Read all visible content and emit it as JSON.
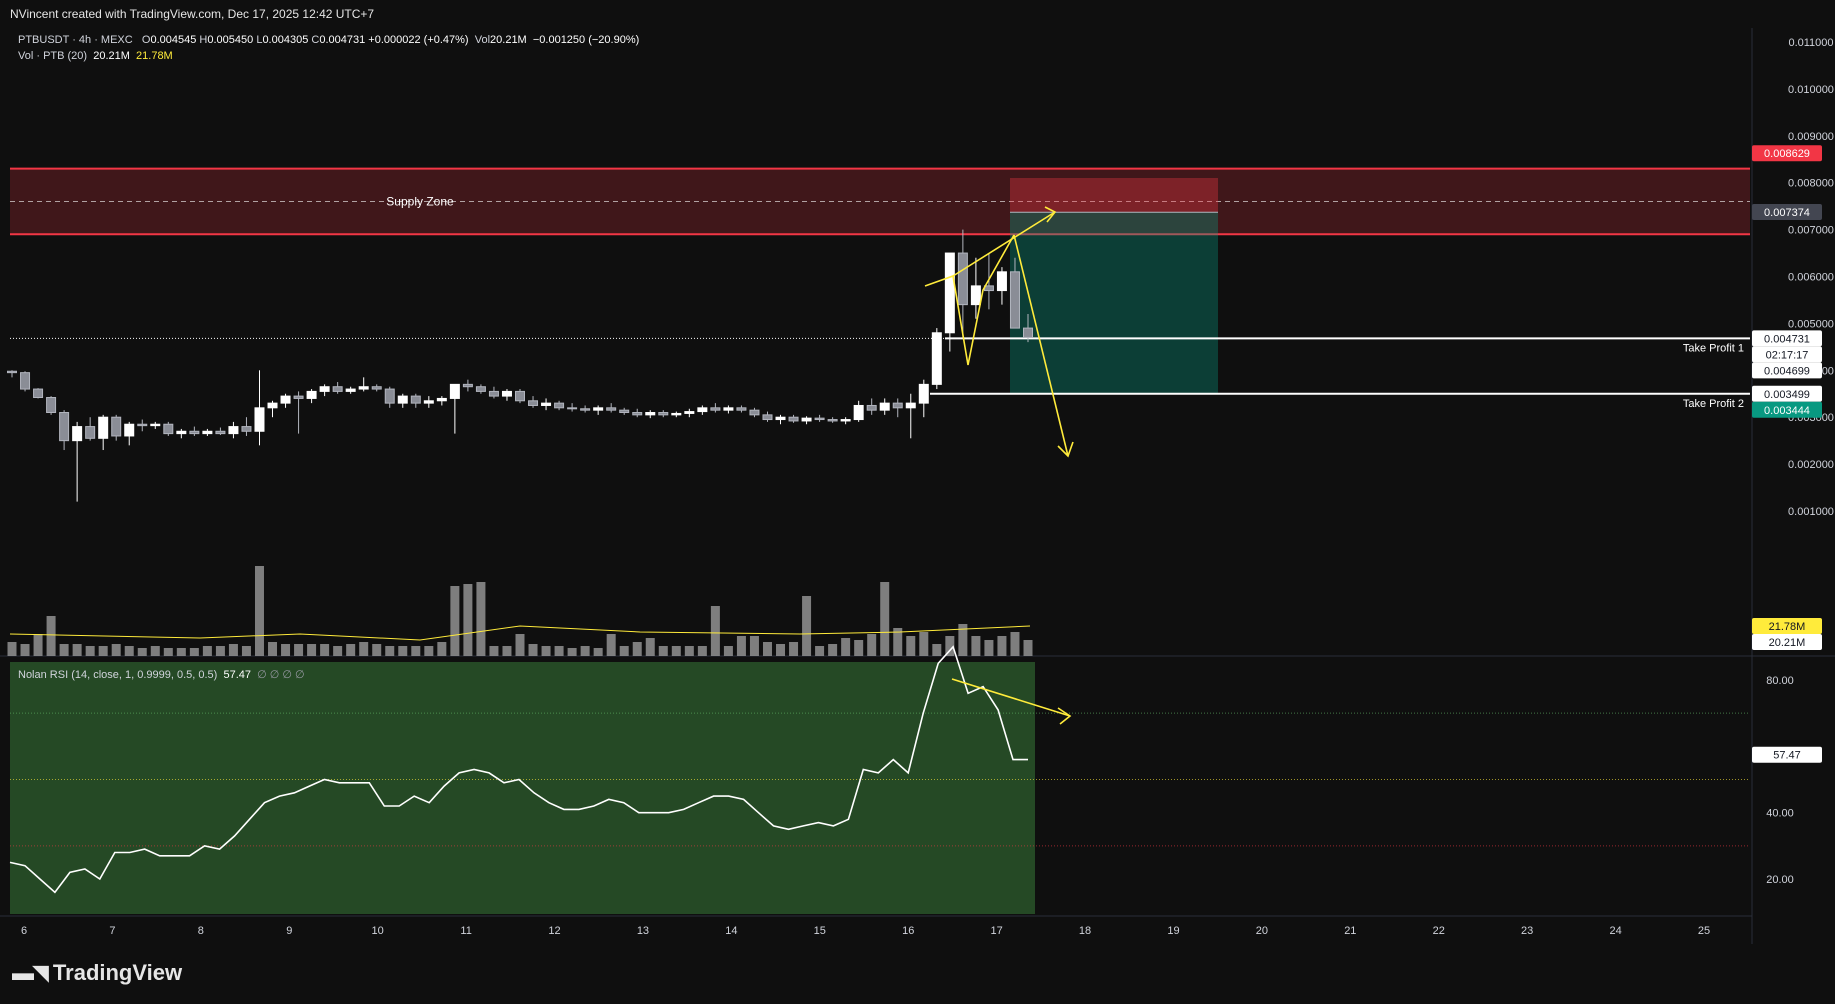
{
  "header": {
    "attribution": "NVincent created with TradingView.com, Dec 17, 2025 12:42 UTC+7"
  },
  "legend": {
    "symbol_line": "PTBUSDT · 4h · MEXC",
    "open_label": "O",
    "open": "0.004545",
    "high_label": "H",
    "high": "0.005450",
    "low_label": "L",
    "low": "0.004305",
    "close_label": "C",
    "close": "0.004731",
    "change": "+0.000022 (+0.47%)",
    "vol_label": "Vol",
    "vol": "20.21M",
    "vol_change": "−0.001250 (−20.90%)",
    "vol_line": "Vol · PTB (20)",
    "vol_value": "20.21M",
    "vol_ma": "21.78M",
    "rsi_line": "Nolan RSI (14, close, 1, 0.9999, 0.5, 0.5)",
    "rsi_value": "57.47",
    "rsi_extra": "∅ ∅ ∅ ∅"
  },
  "annotations": {
    "supply_zone": "Supply Zone",
    "tp1": "Take Profit 1",
    "tp2": "Take Profit 2"
  },
  "price_badges": {
    "red": "0.008629",
    "gray": "0.007374",
    "last": "0.004731",
    "countdown": "02:17:17",
    "mid": "0.004699",
    "tp2": "0.003499",
    "green": "0.003444",
    "vol_ma": "21.78M",
    "vol": "20.21M",
    "rsi": "57.47"
  },
  "branding": {
    "logo_text": "TradingView"
  },
  "colors": {
    "background": "#0f0f0f",
    "supply_zone": "#f23645",
    "bull": "#ffffff",
    "bear": "#b2b5be",
    "annotation": "#ffeb3b",
    "target_zone": "#089981",
    "rsi_fill": "#2e5e2e"
  },
  "chart_data": [
    {
      "type": "candlestick",
      "title": "PTBUSDT · 4h · MEXC",
      "y_ticks": [
        "0.011000",
        "0.010000",
        "0.009000",
        "0.008000",
        "0.007000",
        "0.006000",
        "0.005000",
        "0.004000",
        "0.003000",
        "0.002000",
        "0.001000"
      ],
      "x_ticks": [
        "6",
        "7",
        "8",
        "9",
        "10",
        "11",
        "12",
        "13",
        "14",
        "15",
        "16",
        "17",
        "18",
        "19",
        "20",
        "21",
        "22",
        "23",
        "24",
        "25"
      ],
      "ylim": [
        0.0,
        0.0113
      ],
      "supply_zone": [
        0.0069,
        0.0083
      ],
      "take_profit_1": 0.00468,
      "take_profit_2": 0.003499,
      "candles": [
        [
          0.00398,
          0.004,
          0.00385,
          0.00395
        ],
        [
          0.00395,
          0.00398,
          0.00355,
          0.0036
        ],
        [
          0.0036,
          0.00362,
          0.0034,
          0.00342
        ],
        [
          0.00342,
          0.00345,
          0.00305,
          0.0031
        ],
        [
          0.0031,
          0.00315,
          0.0023,
          0.0025
        ],
        [
          0.0025,
          0.0029,
          0.0012,
          0.0028
        ],
        [
          0.0028,
          0.003,
          0.0025,
          0.00255
        ],
        [
          0.00255,
          0.00305,
          0.0023,
          0.003
        ],
        [
          0.003,
          0.00305,
          0.0025,
          0.0026
        ],
        [
          0.0026,
          0.0029,
          0.0024,
          0.00285
        ],
        [
          0.00285,
          0.00295,
          0.0027,
          0.00282
        ],
        [
          0.00282,
          0.0029,
          0.00275,
          0.00285
        ],
        [
          0.00285,
          0.0029,
          0.0026,
          0.00265
        ],
        [
          0.00265,
          0.00275,
          0.00255,
          0.0027
        ],
        [
          0.0027,
          0.0028,
          0.0026,
          0.00265
        ],
        [
          0.00265,
          0.00275,
          0.0026,
          0.0027
        ],
        [
          0.0027,
          0.00278,
          0.00262,
          0.00265
        ],
        [
          0.00265,
          0.0029,
          0.00255,
          0.0028
        ],
        [
          0.0028,
          0.003,
          0.0026,
          0.0027
        ],
        [
          0.0027,
          0.004,
          0.0024,
          0.0032
        ],
        [
          0.0032,
          0.00335,
          0.003,
          0.0033
        ],
        [
          0.0033,
          0.0035,
          0.0032,
          0.00345
        ],
        [
          0.00345,
          0.00355,
          0.00265,
          0.0034
        ],
        [
          0.0034,
          0.0036,
          0.0033,
          0.00355
        ],
        [
          0.00355,
          0.0037,
          0.00345,
          0.00365
        ],
        [
          0.00365,
          0.00375,
          0.0035,
          0.00355
        ],
        [
          0.00355,
          0.00365,
          0.0035,
          0.0036
        ],
        [
          0.0036,
          0.00385,
          0.00355,
          0.00365
        ],
        [
          0.00365,
          0.0037,
          0.00355,
          0.0036
        ],
        [
          0.0036,
          0.00365,
          0.0032,
          0.0033
        ],
        [
          0.0033,
          0.0035,
          0.0032,
          0.00345
        ],
        [
          0.00345,
          0.0035,
          0.0032,
          0.0033
        ],
        [
          0.0033,
          0.00345,
          0.0032,
          0.00335
        ],
        [
          0.00335,
          0.00345,
          0.00325,
          0.0034
        ],
        [
          0.0034,
          0.00355,
          0.00265,
          0.0037
        ],
        [
          0.0037,
          0.0038,
          0.00355,
          0.00365
        ],
        [
          0.00365,
          0.0037,
          0.0035,
          0.00355
        ],
        [
          0.00355,
          0.00365,
          0.0034,
          0.00345
        ],
        [
          0.00345,
          0.0036,
          0.00335,
          0.00355
        ],
        [
          0.00355,
          0.0036,
          0.0033,
          0.00335
        ],
        [
          0.00335,
          0.00345,
          0.0032,
          0.00325
        ],
        [
          0.00325,
          0.0034,
          0.00315,
          0.0033
        ],
        [
          0.0033,
          0.00335,
          0.00315,
          0.0032
        ],
        [
          0.0032,
          0.0033,
          0.00312,
          0.00318
        ],
        [
          0.00318,
          0.00325,
          0.0031,
          0.00315
        ],
        [
          0.00315,
          0.00325,
          0.00305,
          0.0032
        ],
        [
          0.0032,
          0.0033,
          0.0031,
          0.00315
        ],
        [
          0.00315,
          0.0032,
          0.00305,
          0.0031
        ],
        [
          0.0031,
          0.00318,
          0.003,
          0.00305
        ],
        [
          0.00305,
          0.00315,
          0.00298,
          0.0031
        ],
        [
          0.0031,
          0.00315,
          0.003,
          0.00305
        ],
        [
          0.00305,
          0.00312,
          0.003,
          0.00308
        ],
        [
          0.00308,
          0.00318,
          0.003,
          0.00312
        ],
        [
          0.00312,
          0.00325,
          0.00305,
          0.0032
        ],
        [
          0.0032,
          0.0033,
          0.0031,
          0.00315
        ],
        [
          0.00315,
          0.00325,
          0.00308,
          0.0032
        ],
        [
          0.0032,
          0.00325,
          0.0031,
          0.00315
        ],
        [
          0.00315,
          0.0032,
          0.003,
          0.00305
        ],
        [
          0.00305,
          0.00312,
          0.0029,
          0.00295
        ],
        [
          0.00295,
          0.00305,
          0.00285,
          0.003
        ],
        [
          0.003,
          0.00305,
          0.00288,
          0.00292
        ],
        [
          0.00292,
          0.00302,
          0.00285,
          0.00298
        ],
        [
          0.00298,
          0.00305,
          0.0029,
          0.00295
        ],
        [
          0.00295,
          0.003,
          0.00288,
          0.00292
        ],
        [
          0.00292,
          0.003,
          0.00285,
          0.00295
        ],
        [
          0.00295,
          0.00335,
          0.0029,
          0.00325
        ],
        [
          0.00325,
          0.0034,
          0.00305,
          0.00315
        ],
        [
          0.00315,
          0.0034,
          0.00305,
          0.0033
        ],
        [
          0.0033,
          0.0034,
          0.003,
          0.0032
        ],
        [
          0.0032,
          0.0035,
          0.00255,
          0.0033
        ],
        [
          0.0033,
          0.0038,
          0.003,
          0.0037
        ],
        [
          0.0037,
          0.0049,
          0.0036,
          0.0048
        ],
        [
          0.0048,
          0.0056,
          0.0044,
          0.0065
        ],
        [
          0.0065,
          0.007,
          0.0047,
          0.0054
        ],
        [
          0.0054,
          0.0064,
          0.0051,
          0.0058
        ],
        [
          0.0058,
          0.0065,
          0.0053,
          0.0057
        ],
        [
          0.0057,
          0.0062,
          0.0054,
          0.0061
        ],
        [
          0.0061,
          0.0064,
          0.005,
          0.0049
        ],
        [
          0.0049,
          0.0052,
          0.0046,
          0.0047
        ]
      ]
    },
    {
      "type": "bar",
      "title": "Vol · PTB (20)",
      "volume_ma": 21.78,
      "last_volume": 20.21
    },
    {
      "type": "line",
      "title": "Nolan RSI (14, close, 1, 0.9999, 0.5, 0.5)",
      "y_ticks": [
        "80.00",
        "40.00",
        "20.00"
      ],
      "upper_level": 70,
      "mid_level": 50,
      "lower_level": 30,
      "values": [
        25,
        24,
        20,
        16,
        22,
        23,
        20,
        28,
        28,
        29,
        27,
        27,
        27,
        30,
        29,
        33,
        38,
        43,
        45,
        46,
        48,
        50,
        49,
        49,
        49,
        42,
        42,
        45,
        43,
        48,
        52,
        53,
        52,
        49,
        50,
        46,
        43,
        41,
        41,
        42,
        44,
        43,
        40,
        40,
        40,
        41,
        43,
        45,
        45,
        44,
        40,
        36,
        35,
        36,
        37,
        36,
        38,
        53,
        52,
        56,
        52,
        70,
        85,
        90,
        76,
        78,
        71,
        56,
        56
      ]
    }
  ]
}
